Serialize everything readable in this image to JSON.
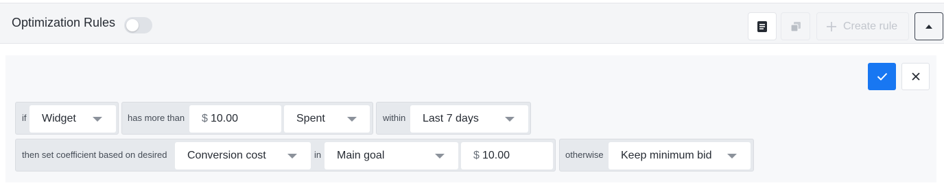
{
  "header": {
    "title": "Optimization Rules",
    "toggle_on": false,
    "notes_icon": "notes-icon",
    "copy_icon": "copy-icon",
    "create_rule_label": "Create rule",
    "collapse_icon": "caret-up-icon"
  },
  "actions": {
    "apply_icon": "check-icon",
    "cancel_icon": "close-icon",
    "apply_color": "#1877f2"
  },
  "rule": {
    "row1": {
      "if_label": "if",
      "entity": "Widget",
      "has_more_than_label": "has more than",
      "amount_currency": "$",
      "amount_value": "10.00",
      "metric": "Spent",
      "within_label": "within",
      "period": "Last 7 days"
    },
    "row2": {
      "then_label": "then set coefficient based on desired",
      "desired": "Conversion cost",
      "in_label": "in",
      "goal": "Main goal",
      "target_currency": "$",
      "target_value": "10.00",
      "otherwise_label": "otherwise",
      "fallback": "Keep minimum bid"
    }
  }
}
